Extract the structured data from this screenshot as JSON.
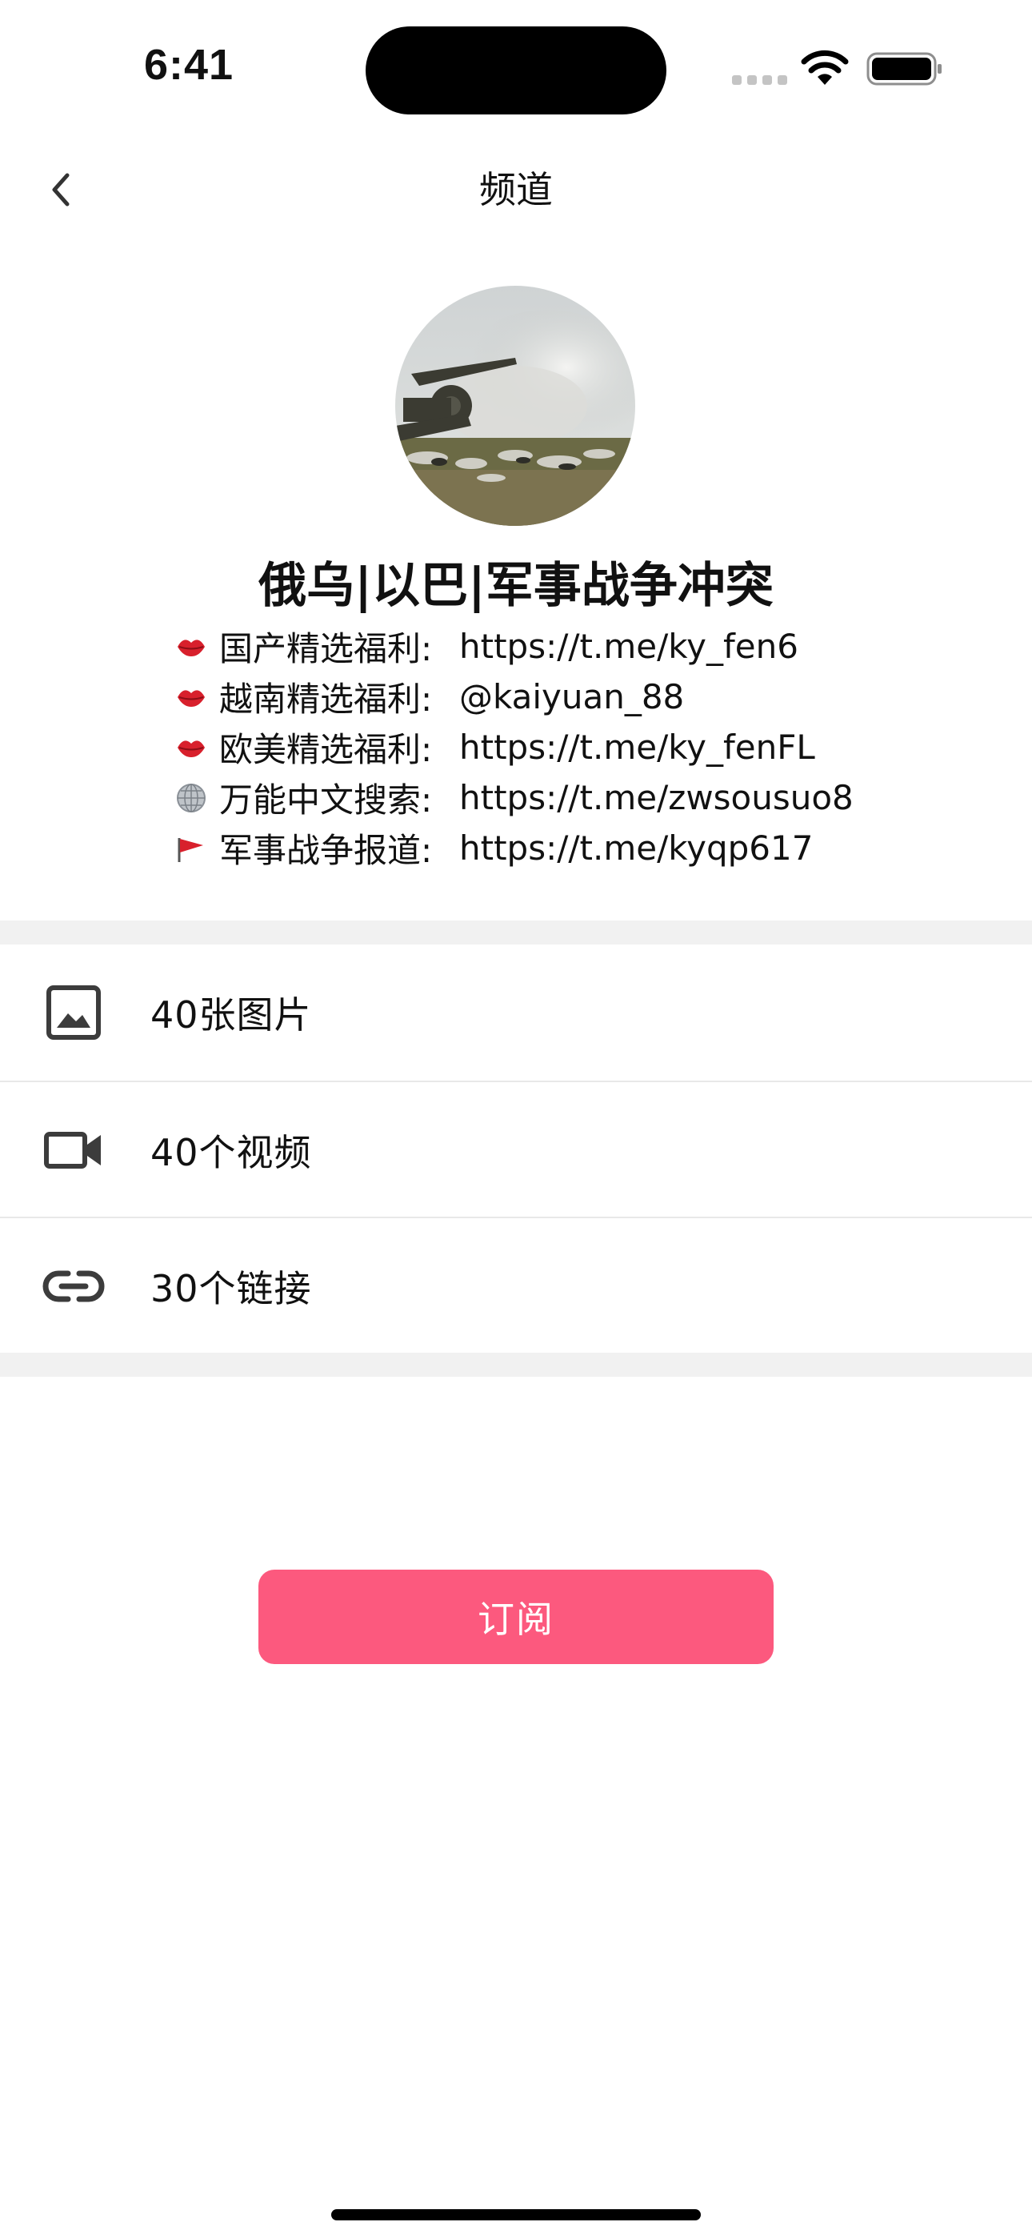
{
  "status_bar": {
    "time": "6:41"
  },
  "nav": {
    "title": "频道",
    "back_icon": "chevron-left-icon"
  },
  "channel": {
    "name": "俄乌|以巴|军事战争冲突",
    "promos": [
      {
        "emoji": "lips-emoji",
        "label": "国产精选福利:",
        "value": "https://t.me/ky_fen6"
      },
      {
        "emoji": "lips-emoji",
        "label": "越南精选福利:",
        "value": "@kaiyuan_88"
      },
      {
        "emoji": "lips-emoji",
        "label": "欧美精选福利:",
        "value": "https://t.me/ky_fenFL"
      },
      {
        "emoji": "globe-emoji",
        "label": "万能中文搜索:",
        "value": "https://t.me/zwsousuo8"
      },
      {
        "emoji": "red-flag-emoji",
        "label": "军事战争报道:",
        "value": "https://t.me/kyqp617"
      }
    ]
  },
  "media": {
    "photos": {
      "label": "40张图片",
      "icon": "image-icon"
    },
    "videos": {
      "label": "40个视频",
      "icon": "video-camera-icon"
    },
    "links": {
      "label": "30个链接",
      "icon": "link-icon"
    }
  },
  "subscribe": {
    "label": "订阅",
    "color": "#fc597e"
  }
}
